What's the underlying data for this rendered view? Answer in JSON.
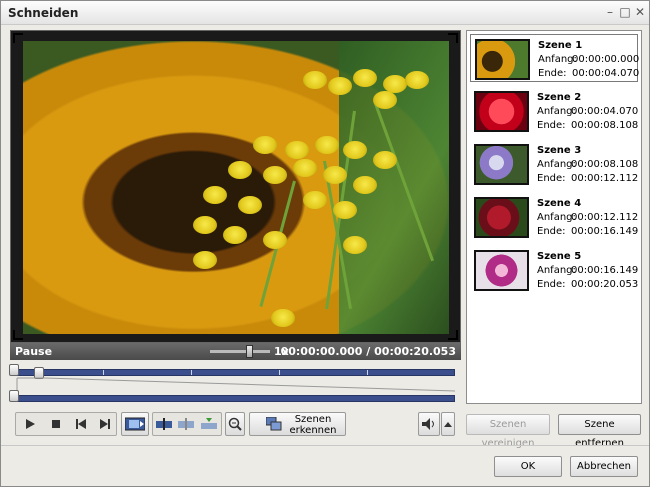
{
  "window": {
    "title": "Schneiden"
  },
  "status": {
    "state": "Pause",
    "speed": "1x",
    "time": "00:00:00.000 / 00:00:20.053"
  },
  "buttons": {
    "detect_scenes": "Szenen erkennen",
    "merge_scenes": "Szenen vereinigen",
    "remove_scene": "Szene entfernen",
    "ok": "OK",
    "cancel": "Abbrechen"
  },
  "scenes": [
    {
      "title": "Szene 1",
      "start_label": "Anfang:",
      "start": "00:00:00.000",
      "end_label": "Ende:",
      "end": "00:00:04.070"
    },
    {
      "title": "Szene 2",
      "start_label": "Anfang:",
      "start": "00:00:04.070",
      "end_label": "Ende:",
      "end": "00:00:08.108"
    },
    {
      "title": "Szene 3",
      "start_label": "Anfang:",
      "start": "00:00:08.108",
      "end_label": "Ende:",
      "end": "00:00:12.112"
    },
    {
      "title": "Szene 4",
      "start_label": "Anfang:",
      "start": "00:00:12.112",
      "end_label": "Ende:",
      "end": "00:00:16.149"
    },
    {
      "title": "Szene 5",
      "start_label": "Anfang:",
      "start": "00:00:16.149",
      "end_label": "Ende:",
      "end": "00:00:20.053"
    }
  ],
  "icons": {
    "minimize": "minimize-icon",
    "maximize": "maximize-icon",
    "close": "close-icon",
    "play": "play-icon",
    "stop": "stop-icon",
    "prev": "previous-icon",
    "next": "next-icon"
  },
  "colors": {
    "timeline": "#3b4f8c",
    "status_bg": "#555555"
  }
}
